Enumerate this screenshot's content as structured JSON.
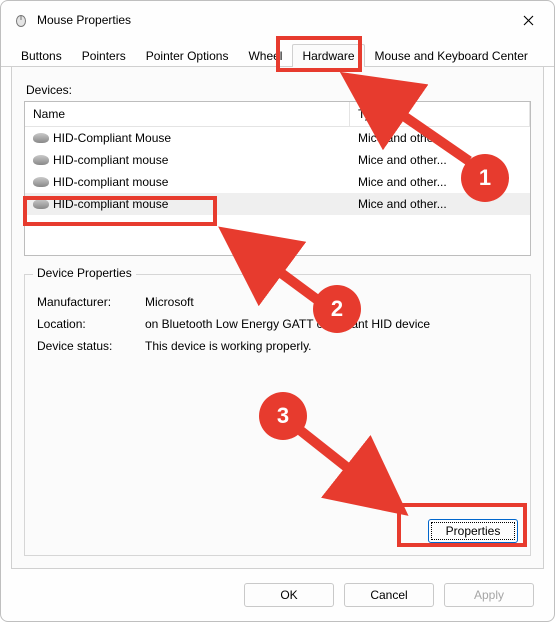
{
  "window": {
    "title": "Mouse Properties"
  },
  "tabs": {
    "items": [
      {
        "label": "Buttons"
      },
      {
        "label": "Pointers"
      },
      {
        "label": "Pointer Options"
      },
      {
        "label": "Wheel"
      },
      {
        "label": "Hardware"
      },
      {
        "label": "Mouse and Keyboard Center"
      }
    ],
    "active": 4
  },
  "devices": {
    "label": "Devices:",
    "head": {
      "name": "Name",
      "type": "Type"
    },
    "rows": [
      {
        "name": "HID-Compliant Mouse",
        "type": "Mice and other..."
      },
      {
        "name": "HID-compliant mouse",
        "type": "Mice and other..."
      },
      {
        "name": "HID-compliant mouse",
        "type": "Mice and other..."
      },
      {
        "name": "HID-compliant mouse",
        "type": "Mice and other..."
      }
    ],
    "selected": 3
  },
  "props": {
    "legend": "Device Properties",
    "manufacturer_k": "Manufacturer:",
    "manufacturer_v": "Microsoft",
    "location_k": "Location:",
    "location_v": "on Bluetooth Low Energy GATT compliant HID device",
    "status_k": "Device status:",
    "status_v": "This device is working properly.",
    "button": "Properties"
  },
  "footer": {
    "ok": "OK",
    "cancel": "Cancel",
    "apply": "Apply"
  },
  "annotations": {
    "step1": "1",
    "step2": "2",
    "step3": "3"
  }
}
